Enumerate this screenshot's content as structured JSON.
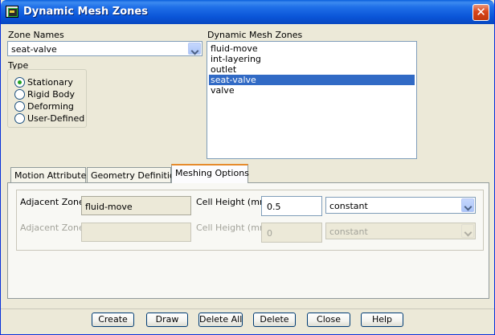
{
  "window": {
    "title": "Dynamic Mesh Zones"
  },
  "zone_names": {
    "label": "Zone Names",
    "selected": "seat-valve"
  },
  "type": {
    "label": "Type",
    "options": [
      {
        "label": "Stationary",
        "selected": true
      },
      {
        "label": "Rigid Body",
        "selected": false
      },
      {
        "label": "Deforming",
        "selected": false
      },
      {
        "label": "User-Defined",
        "selected": false
      }
    ]
  },
  "dynamic_mesh_zones": {
    "label": "Dynamic Mesh Zones",
    "items": [
      "fluid-move",
      "int-layering",
      "outlet",
      "seat-valve",
      "valve"
    ],
    "selected": "seat-valve"
  },
  "tabs": [
    {
      "label": "Motion Attributes",
      "active": false
    },
    {
      "label": "Geometry Definition",
      "active": false
    },
    {
      "label": "Meshing Options",
      "active": true
    }
  ],
  "meshing": {
    "rows": [
      {
        "adjacent_label": "Adjacent Zone",
        "adjacent_value": "fluid-move",
        "height_label": "Cell Height (mm)",
        "height_value": "0.5",
        "method": "constant",
        "enabled": true
      },
      {
        "adjacent_label": "Adjacent Zone",
        "adjacent_value": "",
        "height_label": "Cell Height (mm)",
        "height_value": "0",
        "method": "constant",
        "enabled": false
      }
    ]
  },
  "buttons": [
    "Create",
    "Draw",
    "Delete All",
    "Delete",
    "Close",
    "Help"
  ],
  "colors": {
    "selection": "#316ac5",
    "titlebar": "#0a55d8",
    "tab_accent": "#e68b2c"
  },
  "icons": {
    "app": "fluent-app-icon",
    "close": "close-icon",
    "dropdown": "chevron-down-icon"
  }
}
